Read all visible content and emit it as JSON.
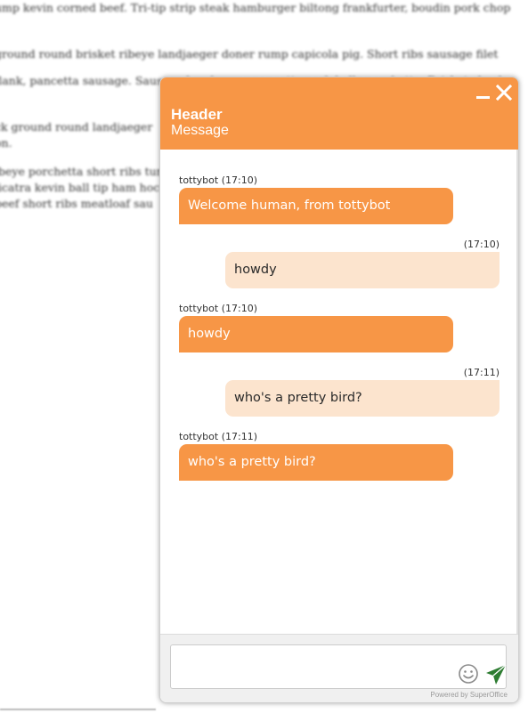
{
  "background_article": {
    "lines": [
      "ump kevin corned beef. Tri-tip strip steak hamburger biltong frankfurter, boudin pork chop",
      "ground round brisket ribeye landjaeger doner rump capicola pig. Short ribs sausage filet",
      "flank, pancetta sausage. Sausage hamburger pancetta pork belly porchetta. Brisket chuck",
      "ck ground round landjaeger",
      "on.",
      "ibeye porchetta short ribs tur",
      "licatra kevin ball tip ham hoc",
      "beef short ribs meatloaf sau"
    ]
  },
  "chat": {
    "header": {
      "title": "Header",
      "message": "Message"
    },
    "messages": [
      {
        "sender": "bot",
        "meta": "tottybot (17:10)",
        "text": "Welcome human, from tottybot"
      },
      {
        "sender": "user",
        "meta": "(17:10)",
        "text": "howdy"
      },
      {
        "sender": "bot",
        "meta": "tottybot (17:10)",
        "text": "howdy"
      },
      {
        "sender": "user",
        "meta": "(17:11)",
        "text": "who's a pretty bird?"
      },
      {
        "sender": "bot",
        "meta": "tottybot (17:11)",
        "text": "who's a pretty bird?"
      }
    ],
    "input": {
      "value": "",
      "placeholder": ""
    },
    "powered_by": "Powered by SuperOffice",
    "icons": {
      "minimize": "minimize-icon",
      "close": "close-icon",
      "emoji": "smiley-icon",
      "send": "send-icon"
    },
    "colors": {
      "accent": "#f79646",
      "user_bubble": "#fce4ce",
      "send_icon": "#2e7d32"
    }
  }
}
